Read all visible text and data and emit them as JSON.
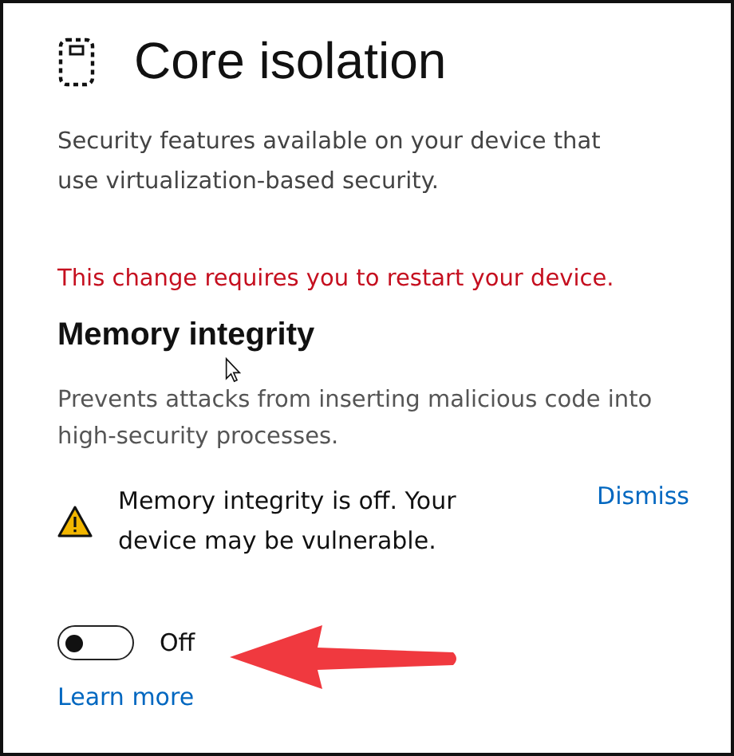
{
  "page": {
    "title": "Core isolation",
    "description": "Security features available on your device that use virtualization-based security."
  },
  "restart_notice": "This change requires you to restart your device.",
  "memory_integrity": {
    "heading": "Memory integrity",
    "description": "Prevents attacks from inserting malicious code into high-security processes.",
    "warning": {
      "message": "Memory integrity is off. Your device may be vulnerable.",
      "dismiss": "Dismiss"
    },
    "toggle": {
      "on": false,
      "label": "Off"
    },
    "learn_more": "Learn more"
  }
}
